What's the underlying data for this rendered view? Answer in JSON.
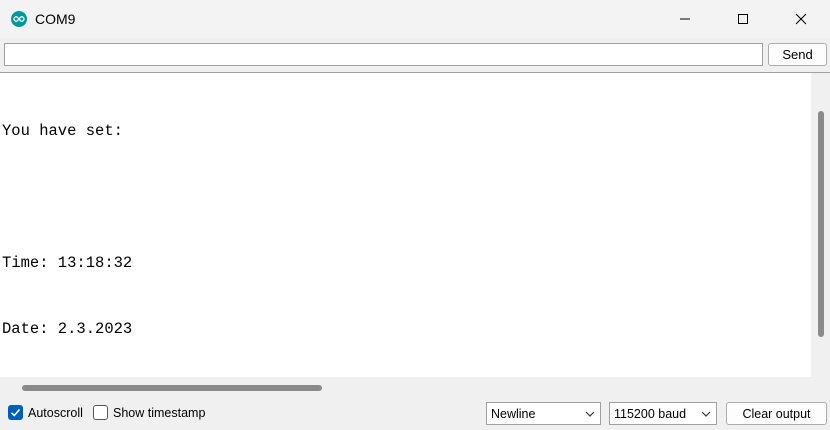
{
  "window": {
    "title": "COM9",
    "icon": "arduino-icon",
    "controls": [
      "minimize-icon",
      "maximize-icon",
      "close-icon"
    ]
  },
  "send_row": {
    "input_value": "",
    "send_label": "Send"
  },
  "output": {
    "lines": [
      "You have set:",
      "",
      "Time: 13:18:32",
      "Date: 2.3.2023"
    ]
  },
  "bottom": {
    "autoscroll": {
      "label": "Autoscroll",
      "checked": true
    },
    "show_timestamp": {
      "label": "Show timestamp",
      "checked": false
    },
    "line_ending": {
      "selected": "Newline"
    },
    "baud_rate": {
      "selected": "115200 baud"
    },
    "clear_label": "Clear output"
  },
  "colors": {
    "accent": "#005fb8",
    "arduino_teal": "#00979d"
  }
}
